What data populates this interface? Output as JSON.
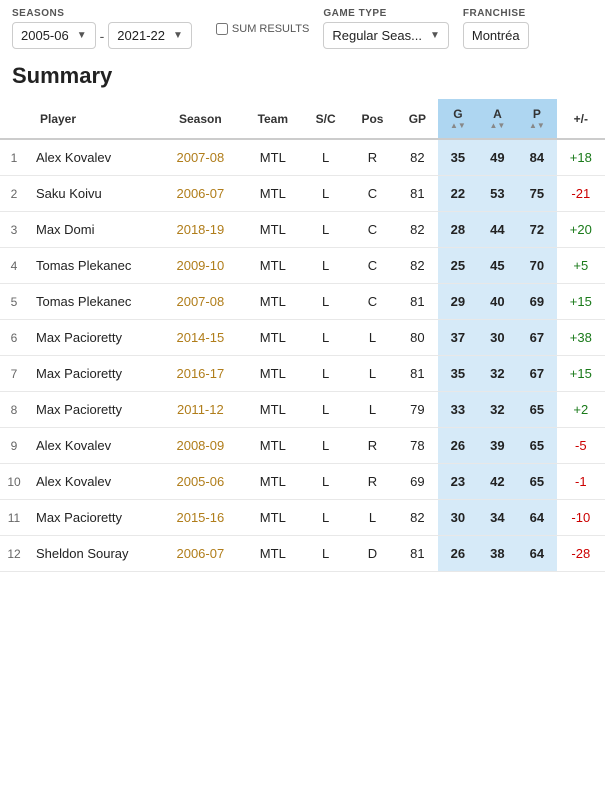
{
  "header": {
    "seasons_label": "SEASONS",
    "sum_results_label": "SUM RESULTS",
    "game_type_label": "GAME TYPE",
    "franchise_label": "FRANCHISE",
    "season_from": "2005-06",
    "season_to": "2021-22",
    "game_type": "Regular Seas...",
    "franchise": "Montréa",
    "sum_results_checked": false
  },
  "summary": {
    "title": "Summary"
  },
  "table": {
    "columns": [
      {
        "key": "rank",
        "label": "",
        "sort": false
      },
      {
        "key": "player",
        "label": "Player",
        "sort": false
      },
      {
        "key": "season",
        "label": "Season",
        "sort": false
      },
      {
        "key": "team",
        "label": "Team",
        "sort": false
      },
      {
        "key": "sc",
        "label": "S/C",
        "sort": false
      },
      {
        "key": "pos",
        "label": "Pos",
        "sort": false
      },
      {
        "key": "gp",
        "label": "GP",
        "sort": false
      },
      {
        "key": "g",
        "label": "G",
        "sort": true
      },
      {
        "key": "a",
        "label": "A",
        "sort": true
      },
      {
        "key": "p",
        "label": "P",
        "sort": true
      },
      {
        "key": "plusminus",
        "label": "+/-",
        "sort": false
      }
    ],
    "rows": [
      {
        "rank": 1,
        "player": "Alex Kovalev",
        "season": "2007-08",
        "team": "MTL",
        "sc": "L",
        "pos": "R",
        "gp": 82,
        "g": 35,
        "a": 49,
        "p": 84,
        "plusminus": "+18"
      },
      {
        "rank": 2,
        "player": "Saku Koivu",
        "season": "2006-07",
        "team": "MTL",
        "sc": "L",
        "pos": "C",
        "gp": 81,
        "g": 22,
        "a": 53,
        "p": 75,
        "plusminus": "-21"
      },
      {
        "rank": 3,
        "player": "Max Domi",
        "season": "2018-19",
        "team": "MTL",
        "sc": "L",
        "pos": "C",
        "gp": 82,
        "g": 28,
        "a": 44,
        "p": 72,
        "plusminus": "+20"
      },
      {
        "rank": 4,
        "player": "Tomas Plekanec",
        "season": "2009-10",
        "team": "MTL",
        "sc": "L",
        "pos": "C",
        "gp": 82,
        "g": 25,
        "a": 45,
        "p": 70,
        "plusminus": "+5"
      },
      {
        "rank": 5,
        "player": "Tomas Plekanec",
        "season": "2007-08",
        "team": "MTL",
        "sc": "L",
        "pos": "C",
        "gp": 81,
        "g": 29,
        "a": 40,
        "p": 69,
        "plusminus": "+15"
      },
      {
        "rank": 6,
        "player": "Max Pacioretty",
        "season": "2014-15",
        "team": "MTL",
        "sc": "L",
        "pos": "L",
        "gp": 80,
        "g": 37,
        "a": 30,
        "p": 67,
        "plusminus": "+38"
      },
      {
        "rank": 7,
        "player": "Max Pacioretty",
        "season": "2016-17",
        "team": "MTL",
        "sc": "L",
        "pos": "L",
        "gp": 81,
        "g": 35,
        "a": 32,
        "p": 67,
        "plusminus": "+15"
      },
      {
        "rank": 8,
        "player": "Max Pacioretty",
        "season": "2011-12",
        "team": "MTL",
        "sc": "L",
        "pos": "L",
        "gp": 79,
        "g": 33,
        "a": 32,
        "p": 65,
        "plusminus": "+2"
      },
      {
        "rank": 9,
        "player": "Alex Kovalev",
        "season": "2008-09",
        "team": "MTL",
        "sc": "L",
        "pos": "R",
        "gp": 78,
        "g": 26,
        "a": 39,
        "p": 65,
        "plusminus": "-5"
      },
      {
        "rank": 10,
        "player": "Alex Kovalev",
        "season": "2005-06",
        "team": "MTL",
        "sc": "L",
        "pos": "R",
        "gp": 69,
        "g": 23,
        "a": 42,
        "p": 65,
        "plusminus": "-1"
      },
      {
        "rank": 11,
        "player": "Max Pacioretty",
        "season": "2015-16",
        "team": "MTL",
        "sc": "L",
        "pos": "L",
        "gp": 82,
        "g": 30,
        "a": 34,
        "p": 64,
        "plusminus": "-10"
      },
      {
        "rank": 12,
        "player": "Sheldon Souray",
        "season": "2006-07",
        "team": "MTL",
        "sc": "L",
        "pos": "D",
        "gp": 81,
        "g": 26,
        "a": 38,
        "p": 64,
        "plusminus": "-28"
      }
    ]
  }
}
